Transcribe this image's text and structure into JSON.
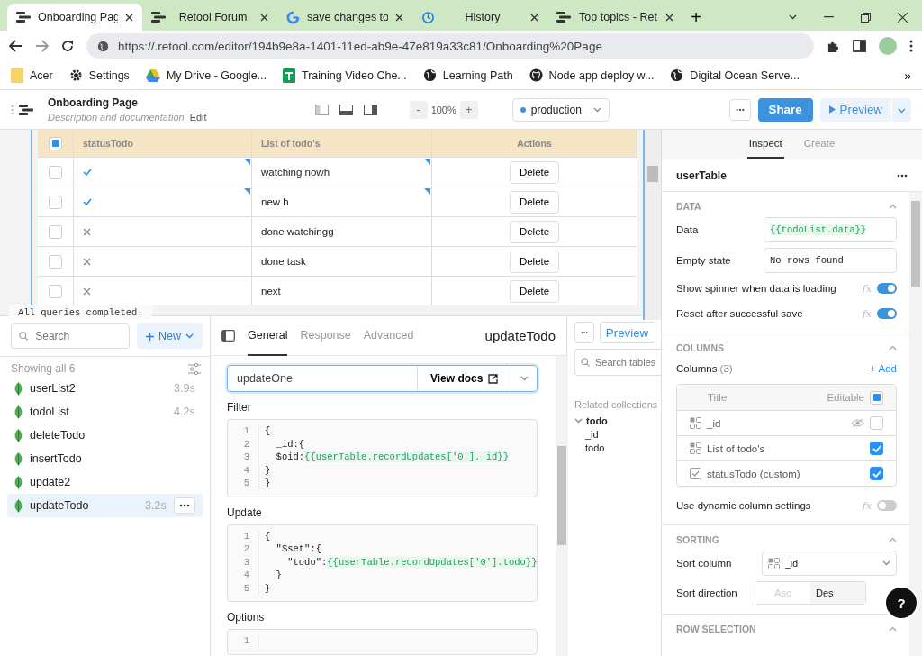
{
  "browser": {
    "tabs": [
      {
        "title": "Onboarding Pag",
        "kind": "retool",
        "selected": true
      },
      {
        "title": "Retool Forum",
        "kind": "retool",
        "selected": false
      },
      {
        "title": "save changes to",
        "kind": "google",
        "selected": false
      },
      {
        "title": "History",
        "kind": "history",
        "selected": false
      },
      {
        "title": "Top topics - Ret",
        "kind": "retool",
        "selected": false
      }
    ],
    "new_tab": "+",
    "address": "https://.retool.com/editor/194b9e8a-1401-11ed-ab9e-47e819a33c81/Onboarding%20Page",
    "bookmarks": [
      {
        "label": "Acer",
        "kind": "folder"
      },
      {
        "label": "Settings",
        "kind": "gear"
      },
      {
        "label": "My Drive - Google...",
        "kind": "drive"
      },
      {
        "label": "Training Video Che...",
        "kind": "sheets"
      },
      {
        "label": "Learning Path",
        "kind": "globe"
      },
      {
        "label": "Node app deploy w...",
        "kind": "github"
      },
      {
        "label": "Digital Ocean Serve...",
        "kind": "globe"
      }
    ],
    "more_bookmarks": "»"
  },
  "header": {
    "title": "Onboarding Page",
    "description": "Description and documentation",
    "edit": "Edit",
    "zoom_out": "-",
    "zoom": "100%",
    "zoom_in": "+",
    "environment": "production",
    "share": "Share",
    "preview": "Preview"
  },
  "table": {
    "columns": [
      "statusTodo",
      "List of todo's",
      "Actions"
    ],
    "header_partial": true,
    "rows": [
      {
        "selected": false,
        "done": true,
        "changed": true,
        "todo": "watching nowh",
        "action": "Delete"
      },
      {
        "selected": false,
        "done": true,
        "changed": true,
        "todo": "new h",
        "action": "Delete"
      },
      {
        "selected": false,
        "done": false,
        "changed": false,
        "todo": "done watchingg",
        "action": "Delete"
      },
      {
        "selected": false,
        "done": false,
        "changed": false,
        "todo": "done task",
        "action": "Delete"
      },
      {
        "selected": false,
        "done": false,
        "changed": false,
        "todo": "next",
        "action": "Delete"
      }
    ]
  },
  "status_message": "All queries completed.",
  "queries": {
    "search_placeholder": "Search",
    "new": "New",
    "count_label": "Showing all 6",
    "items": [
      {
        "name": "userList2",
        "time": "3.9s",
        "selected": false
      },
      {
        "name": "todoList",
        "time": "4.2s",
        "selected": false
      },
      {
        "name": "deleteTodo",
        "selected": false
      },
      {
        "name": "insertTodo",
        "selected": false
      },
      {
        "name": "update2",
        "selected": false
      },
      {
        "name": "updateTodo",
        "time": "3.2s",
        "selected": true
      }
    ]
  },
  "editor": {
    "tabs": [
      {
        "label": "General",
        "selected": true
      },
      {
        "label": "Response",
        "selected": false
      },
      {
        "label": "Advanced",
        "selected": false
      }
    ],
    "title": "updateTodo",
    "preview": "Preview",
    "action": "updateOne",
    "view_docs": "View docs",
    "sections": [
      {
        "label": "Filter",
        "lines": [
          {
            "num": "1",
            "code": "{"
          },
          {
            "num": "2",
            "code": "  _id:{"
          },
          {
            "num": "3",
            "code": "  $oid:",
            "template": "{{userTable.recordUpdates['0']._id}}"
          },
          {
            "num": "4",
            "code": "}"
          },
          {
            "num": "5",
            "code": "}"
          }
        ]
      },
      {
        "label": "Update",
        "lines": [
          {
            "num": "1",
            "code": "{"
          },
          {
            "num": "2",
            "code": "  \"$set\":{"
          },
          {
            "num": "3",
            "code": "    \"todo\":",
            "template": "{{userTable.recordUpdates['0'].todo}}"
          },
          {
            "num": "4",
            "code": "  }"
          },
          {
            "num": "5",
            "code": "}"
          }
        ]
      },
      {
        "label": "Options",
        "lines": [
          {
            "num": "1"
          }
        ]
      }
    ]
  },
  "schema": {
    "search_placeholder": "Search tables",
    "heading": "Related collections",
    "tree": [
      {
        "label": "todo",
        "expanded": true,
        "children": [
          {
            "label": "_id"
          },
          {
            "label": "todo"
          }
        ]
      }
    ]
  },
  "inspector": {
    "tabs": [
      {
        "label": "Inspect",
        "selected": true
      },
      {
        "label": "Create",
        "selected": false
      }
    ],
    "component": "userTable",
    "data_section": {
      "title": "DATA",
      "fields": [
        {
          "kind": "code",
          "label": "Data",
          "value": "{{todoList.data}}"
        },
        {
          "kind": "text",
          "label": "Empty state",
          "value": "No rows found"
        }
      ],
      "toggles": [
        {
          "label": "Show spinner when data is loading",
          "fx": "fx",
          "on": true
        },
        {
          "label": "Reset after successful save",
          "fx": "fx",
          "on": true
        }
      ]
    },
    "columns_section": {
      "title": "COLUMNS",
      "label": "Columns",
      "count": "(3)",
      "add": "+ Add",
      "header_title": "Title",
      "header_editable": "Editable",
      "all_editable_partial": true,
      "rows": [
        {
          "kind": "field",
          "title": "_id",
          "hidden": true,
          "editable": false
        },
        {
          "kind": "field",
          "title": "List of todo's",
          "hidden": false,
          "editable": true
        },
        {
          "kind": "custom",
          "title": "statusTodo (custom)",
          "hidden": false,
          "editable": true
        }
      ],
      "toggle": {
        "label": "Use dynamic column settings",
        "fx": "fx",
        "on": false
      }
    },
    "sorting_section": {
      "title": "SORTING",
      "sort_column_label": "Sort column",
      "sort_column": "_id",
      "sort_direction_label": "Sort direction",
      "directions": [
        {
          "label": "Asc",
          "selected": false
        },
        {
          "label": "Des",
          "selected": true
        }
      ]
    },
    "next_section": {
      "title": "ROW SELECTION"
    },
    "help": "?"
  }
}
